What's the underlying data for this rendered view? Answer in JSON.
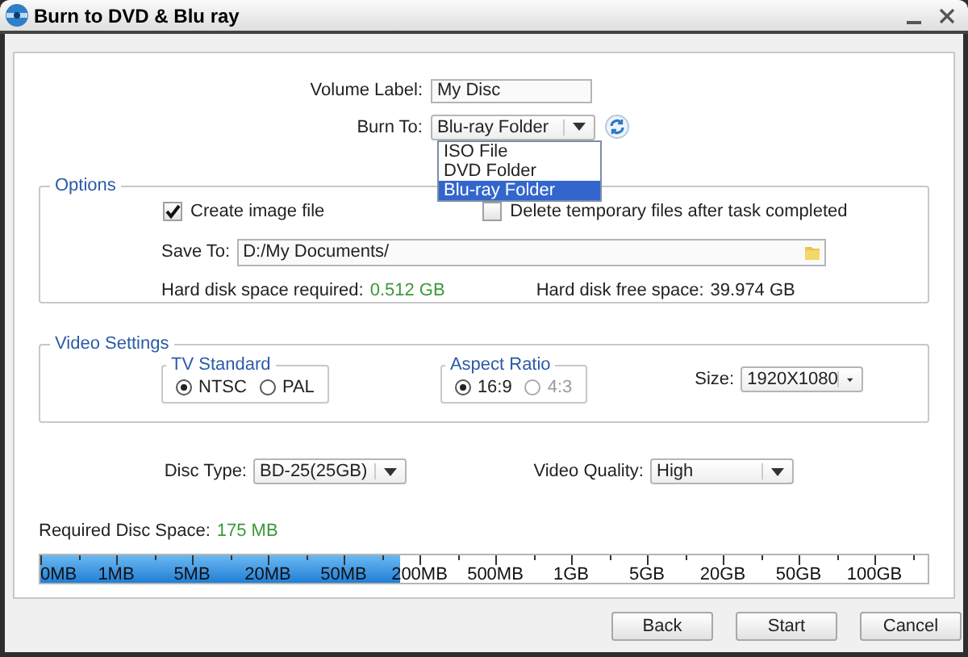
{
  "window": {
    "title": "Burn to DVD & Blu ray"
  },
  "volume_label": {
    "label": "Volume Label:",
    "value": "My Disc"
  },
  "burn_to": {
    "label": "Burn To:",
    "value": "Blu-ray Folder",
    "expanded": true,
    "options": [
      {
        "label": "ISO File",
        "selected": false
      },
      {
        "label": "DVD Folder",
        "selected": false
      },
      {
        "label": "Blu-ray Folder",
        "selected": true
      }
    ]
  },
  "options": {
    "title": "Options",
    "checkboxes": [
      {
        "label": "Create image file",
        "checked": true
      },
      {
        "label": "Delete temporary files after task completed",
        "checked": false
      }
    ],
    "save_to": {
      "label": "Save To:",
      "value": "D:/My Documents/"
    },
    "space_required": {
      "label": "Hard disk space required:",
      "value": "0.512 GB"
    },
    "free_space": {
      "label": "Hard disk free space:",
      "value": "39.974 GB"
    }
  },
  "video_settings": {
    "title": "Video Settings",
    "groups": [
      {
        "title": "TV Standard",
        "radios": [
          {
            "label": "NTSC",
            "selected": true,
            "disabled": false
          },
          {
            "label": "PAL",
            "selected": false,
            "disabled": false
          }
        ]
      },
      {
        "title": "Aspect Ratio",
        "radios": [
          {
            "label": "16:9",
            "selected": true,
            "disabled": false
          },
          {
            "label": "4:3",
            "selected": false,
            "disabled": true
          }
        ]
      }
    ],
    "size": {
      "label": "Size:",
      "value": "1920X1080"
    }
  },
  "disc_type": {
    "label": "Disc Type:",
    "value": "BD-25(25GB)"
  },
  "video_quality": {
    "label": "Video Quality:",
    "value": "High"
  },
  "required_disc_space": {
    "label": "Required Disc Space:",
    "value": "175 MB",
    "level": 0.405,
    "scale": [
      "0MB",
      "1MB",
      "5MB",
      "20MB",
      "50MB",
      "200MB",
      "500MB",
      "1GB",
      "5GB",
      "20GB",
      "50GB",
      "100GB"
    ]
  },
  "buttons": [
    "Back",
    "Start",
    "Cancel"
  ]
}
